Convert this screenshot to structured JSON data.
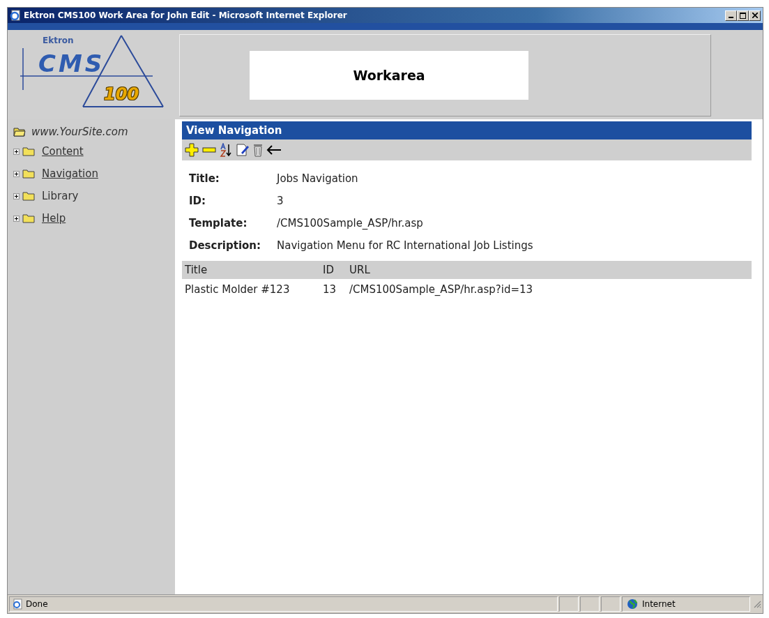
{
  "window": {
    "title": "Ektron CMS100 Work Area for John Edit - Microsoft Internet Explorer"
  },
  "logo": {
    "brand": "Ektron",
    "product": "CMS",
    "edition": "100"
  },
  "header": {
    "title": "Workarea"
  },
  "sidebar": {
    "root": "www.YourSite.com",
    "items": [
      {
        "label": "Content",
        "link": true
      },
      {
        "label": "Navigation",
        "link": true
      },
      {
        "label": "Library",
        "link": false
      },
      {
        "label": "Help",
        "link": true
      }
    ]
  },
  "panel": {
    "title": "View Navigation",
    "toolbar": [
      {
        "kind": "add"
      },
      {
        "kind": "remove"
      },
      {
        "kind": "sort"
      },
      {
        "kind": "edit"
      },
      {
        "kind": "delete"
      },
      {
        "kind": "back"
      }
    ],
    "fields": [
      {
        "label": "Title:",
        "value": "Jobs Navigation"
      },
      {
        "label": "ID:",
        "value": "3"
      },
      {
        "label": "Template:",
        "value": "/CMS100Sample_ASP/hr.asp"
      },
      {
        "label": "Description:",
        "value": "Navigation Menu for RC International Job Listings"
      }
    ],
    "table": {
      "columns": [
        "Title",
        "ID",
        "URL"
      ],
      "rows": [
        [
          "Plastic Molder #123",
          "13",
          "/CMS100Sample_ASP/hr.asp?id=13"
        ]
      ]
    }
  },
  "status_bar": {
    "text": "Done",
    "zone": "Internet"
  }
}
